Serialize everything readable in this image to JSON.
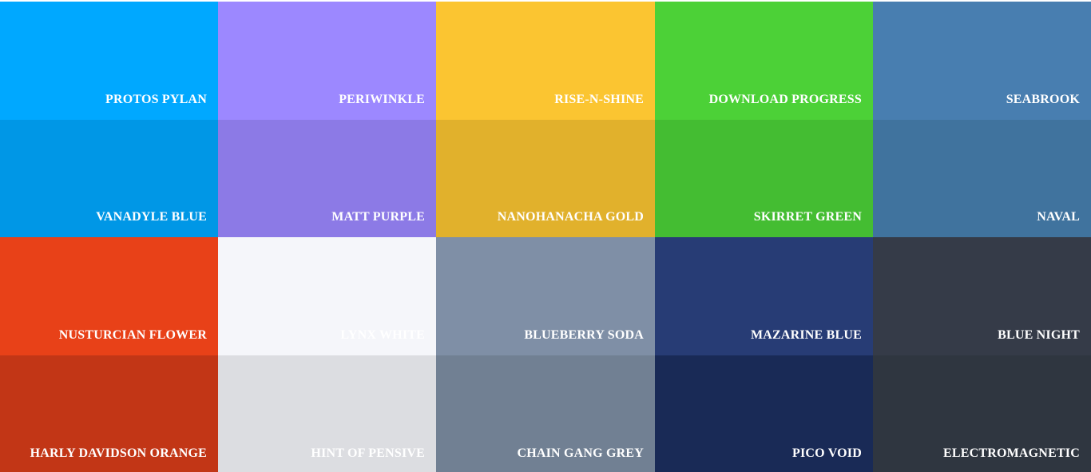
{
  "palette": {
    "swatches": [
      {
        "name": "PROTOS PYLAN",
        "color": "#00a8ff"
      },
      {
        "name": "PERIWINKLE",
        "color": "#9c88ff"
      },
      {
        "name": "RISE-N-SHINE",
        "color": "#fbc531"
      },
      {
        "name": "DOWNLOAD PROGRESS",
        "color": "#4cd137"
      },
      {
        "name": "SEABROOK",
        "color": "#487eb0"
      },
      {
        "name": "VANADYLE BLUE",
        "color": "#0097e6"
      },
      {
        "name": "MATT PURPLE",
        "color": "#8c7ae6"
      },
      {
        "name": "NANOHANACHA GOLD",
        "color": "#e1b12c"
      },
      {
        "name": "SKIRRET GREEN",
        "color": "#44bd32"
      },
      {
        "name": "NAVAL",
        "color": "#40739e"
      },
      {
        "name": "NUSTURCIAN FLOWER",
        "color": "#e84118"
      },
      {
        "name": "LYNX WHITE",
        "color": "#f5f6fa"
      },
      {
        "name": "BLUEBERRY SODA",
        "color": "#7f8fa6"
      },
      {
        "name": "MAZARINE BLUE",
        "color": "#273c75"
      },
      {
        "name": "BLUE NIGHT",
        "color": "#353b48"
      },
      {
        "name": "HARLY DAVIDSON ORANGE",
        "color": "#c23616"
      },
      {
        "name": "HINT OF PENSIVE",
        "color": "#dcdde1"
      },
      {
        "name": "CHAIN GANG GREY",
        "color": "#718093"
      },
      {
        "name": "PICO VOID",
        "color": "#192a56"
      },
      {
        "name": "ELECTROMAGNETIC",
        "color": "#2f3640"
      }
    ]
  }
}
